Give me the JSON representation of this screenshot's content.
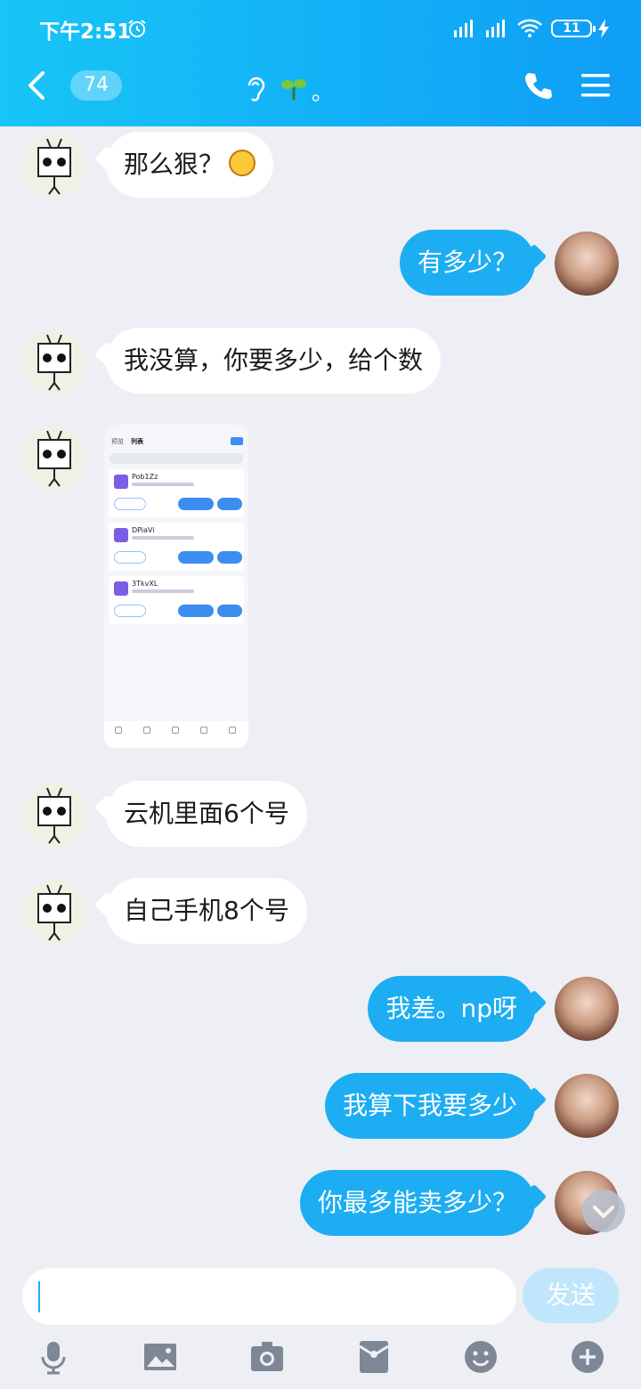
{
  "status_bar": {
    "time": "下午2:51",
    "battery": "11",
    "network": "HD"
  },
  "header": {
    "unread_count": "74",
    "title_suffix": "。"
  },
  "messages": [
    {
      "side": "left",
      "text": "那么狠？"
    },
    {
      "side": "right",
      "text": "有多少？"
    },
    {
      "side": "left",
      "text": "我没算，你要多少，给个数"
    },
    {
      "side": "left",
      "type": "image"
    },
    {
      "side": "left",
      "text": "云机里面6个号"
    },
    {
      "side": "left",
      "text": "自己手机8个号"
    },
    {
      "side": "right",
      "text": "我差。np呀"
    },
    {
      "side": "right",
      "text": "我算下我要多少"
    },
    {
      "side": "right",
      "text": "你最多能卖多少？"
    }
  ],
  "shared_image": {
    "tabs": [
      "预览",
      "列表"
    ],
    "cards": [
      "Pob1Zz",
      "DPiaVi",
      "3TkvXL"
    ]
  },
  "composer": {
    "send_label": "发送",
    "value": ""
  },
  "colors": {
    "header": "#13b4f7",
    "bubble_right": "#1dadf2",
    "bubble_left": "#ffffff",
    "background": "#edeff4"
  }
}
